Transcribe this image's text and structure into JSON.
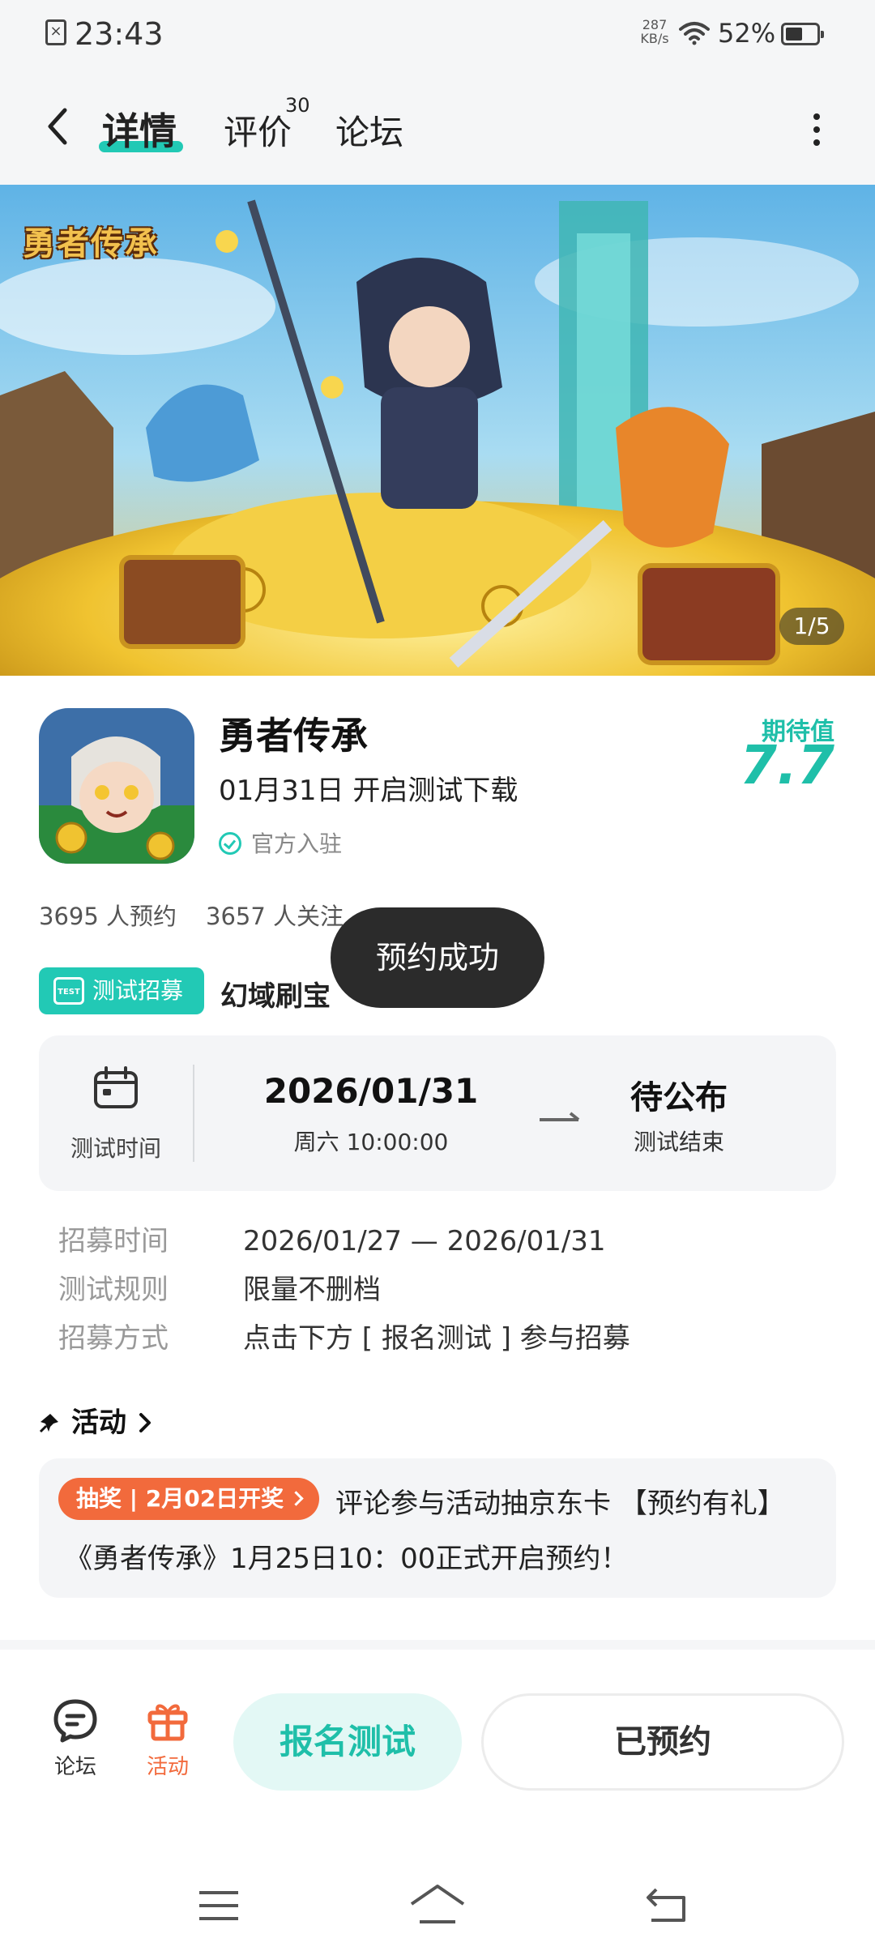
{
  "status_bar": {
    "time": "23:43",
    "net_speed_value": "287",
    "net_speed_unit": "KB/s",
    "battery": "52%"
  },
  "nav": {
    "tabs": [
      {
        "label": "详情"
      },
      {
        "label": "评价",
        "badge": "30"
      },
      {
        "label": "论坛"
      }
    ]
  },
  "banner": {
    "logo_text": "勇者传承",
    "counter": "1/5"
  },
  "app": {
    "name": "勇者传承",
    "release": "01月31日 开启测试下载",
    "official": "官方入驻",
    "expect_label": "期待值",
    "expect_value": "7.7",
    "reservations": "3695 人预约",
    "followers": "3657 人关注"
  },
  "recruit": {
    "badge": "测试招募",
    "badge_icon_text": "TEST",
    "name": "幻域刷宝"
  },
  "toast": "预约成功",
  "test_card": {
    "label": "测试时间",
    "start_date": "2026/01/31",
    "start_sub": "周六  10:00:00",
    "end_title": "待公布",
    "end_sub": "测试结束"
  },
  "details": [
    {
      "key": "招募时间",
      "value": "2026/01/27 — 2026/01/31"
    },
    {
      "key": "测试规则",
      "value": "限量不删档"
    },
    {
      "key": "招募方式",
      "value": "点击下方 [ 报名测试 ] 参与招募"
    }
  ],
  "activity": {
    "title": "活动",
    "tag": "抽奖 | 2月02日开奖",
    "line1": "评论参与活动抽京东卡 【预约有礼】",
    "line2": "《勇者传承》1月25日10：00正式开启预约！"
  },
  "bottom_bar": {
    "forum_label": "论坛",
    "activity_label": "活动",
    "signup_label": "报名测试",
    "reserved_label": "已预约"
  },
  "colors": {
    "accent": "#22c9b5",
    "orange": "#f26a3c",
    "toast_bg": "#2b2b2b"
  }
}
